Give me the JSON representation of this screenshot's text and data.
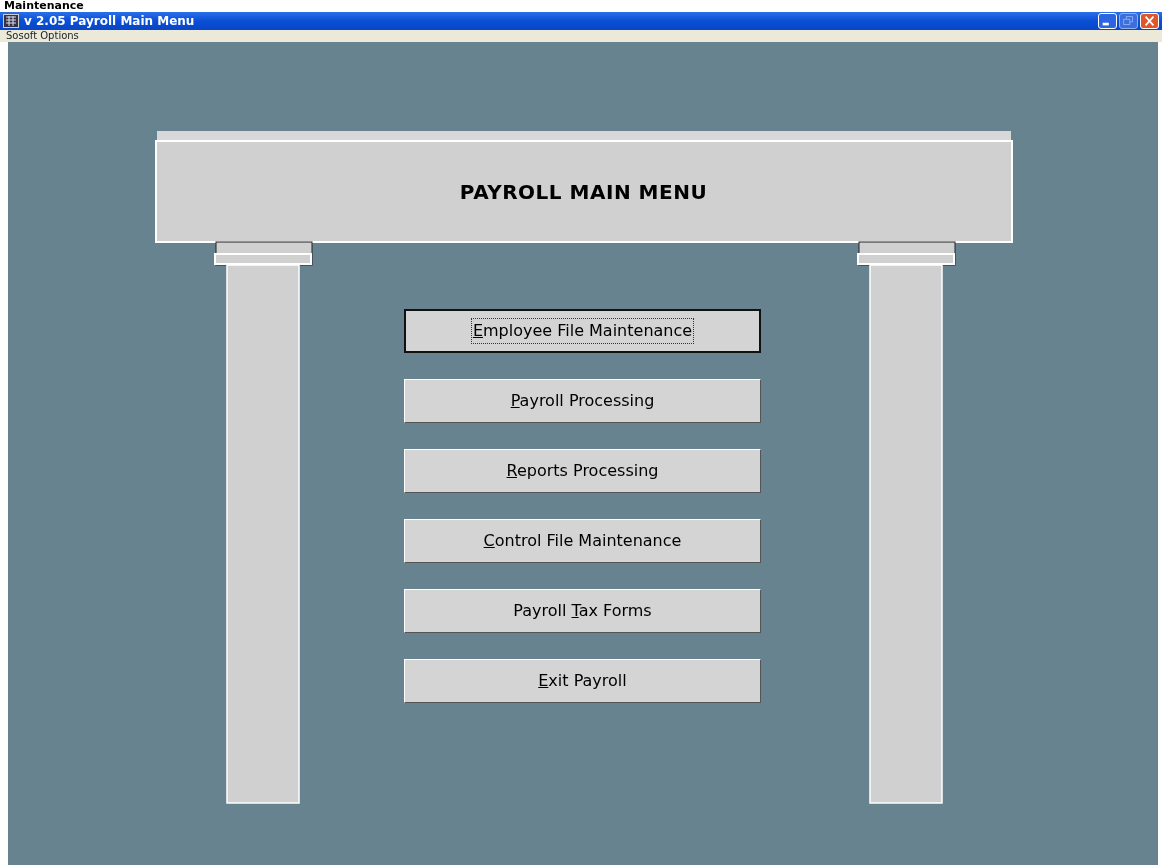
{
  "page_heading": "Maintenance",
  "window": {
    "title": "v 2.05 Payroll Main Menu"
  },
  "menu_bar": [
    "Sosoft Options"
  ],
  "form": {
    "title": "PAYROLL MAIN MENU",
    "buttons": [
      {
        "key": "E",
        "after": "mployee File Maintenance",
        "focused": true
      },
      {
        "key": "P",
        "after": "ayroll Processing",
        "focused": false
      },
      {
        "key": "R",
        "after": "eports Processing",
        "focused": false
      },
      {
        "key": "C",
        "after": "ontrol File Maintenance",
        "focused": false
      },
      {
        "before": "Payroll ",
        "key": "T",
        "after": "ax Forms",
        "focused": false
      },
      {
        "key": "E",
        "after": "xit Payroll",
        "focused": false
      }
    ]
  }
}
